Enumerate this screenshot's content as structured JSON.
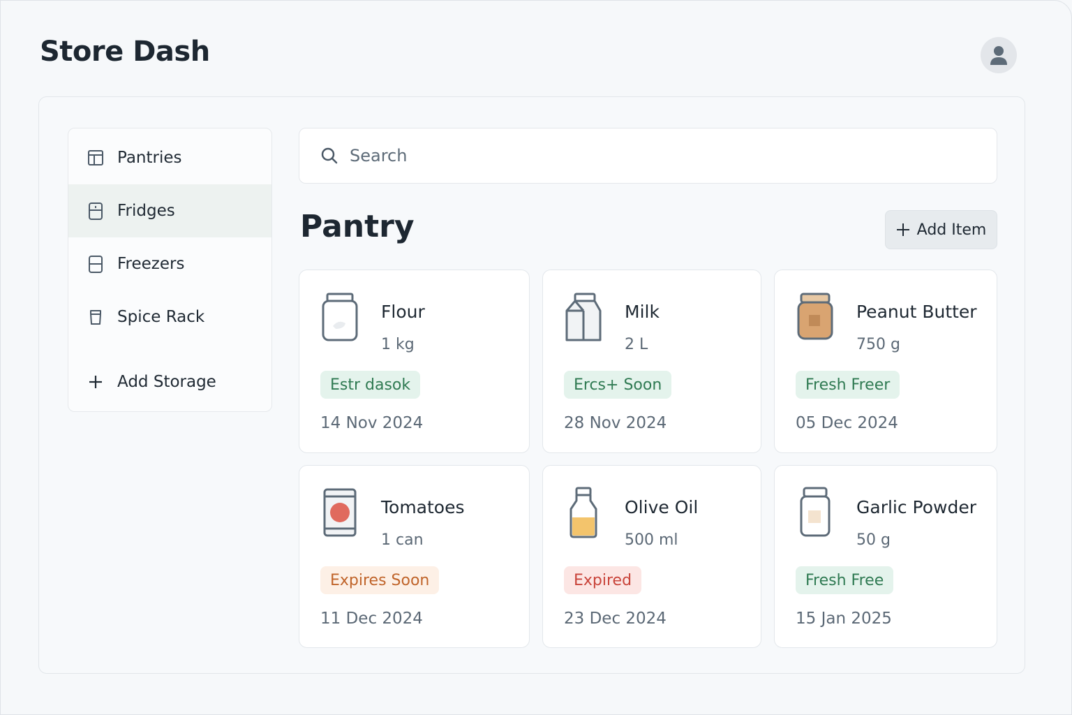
{
  "app": {
    "title": "Store Dash"
  },
  "sidebar": {
    "items": [
      {
        "label": "Pantries",
        "icon": "pantry-icon"
      },
      {
        "label": "Fridges",
        "icon": "fridge-icon",
        "active": true
      },
      {
        "label": "Freezers",
        "icon": "freezer-icon"
      },
      {
        "label": "Spice Rack",
        "icon": "spice-jar-icon"
      }
    ],
    "add_label": "Add Storage"
  },
  "search": {
    "placeholder": "Search"
  },
  "main": {
    "title": "Pantry",
    "add_item_label": "Add Item"
  },
  "items": [
    {
      "name": "Flour",
      "qty": "1 kg",
      "status": "Estr dasok",
      "status_type": "fresh",
      "date": "14 Nov 2024",
      "icon": "flour-jar-icon"
    },
    {
      "name": "Milk",
      "qty": "2 L",
      "status": "Ercs+ Soon",
      "status_type": "fresh",
      "date": "28 Nov 2024",
      "icon": "milk-carton-icon"
    },
    {
      "name": "Peanut Butter",
      "qty": "750 g",
      "status": "Fresh Freer",
      "status_type": "fresh",
      "date": "05 Dec 2024",
      "icon": "peanut-butter-jar-icon"
    },
    {
      "name": "Tomatoes",
      "qty": "1 can",
      "status": "Expires Soon",
      "status_type": "soon",
      "date": "11 Dec 2024",
      "icon": "tomato-can-icon"
    },
    {
      "name": "Olive Oil",
      "qty": "500 ml",
      "status": "Expired",
      "status_type": "expired",
      "date": "23 Dec 2024",
      "icon": "olive-oil-bottle-icon"
    },
    {
      "name": "Garlic Powder",
      "qty": "50 g",
      "status": "Fresh Free",
      "status_type": "fresh",
      "date": "15 Jan 2025",
      "icon": "garlic-powder-jar-icon"
    }
  ],
  "colors": {
    "fresh": "#2f7a52",
    "expires_soon": "#c0642a",
    "expired": "#c9443a",
    "active_nav": "#edf2f0"
  }
}
